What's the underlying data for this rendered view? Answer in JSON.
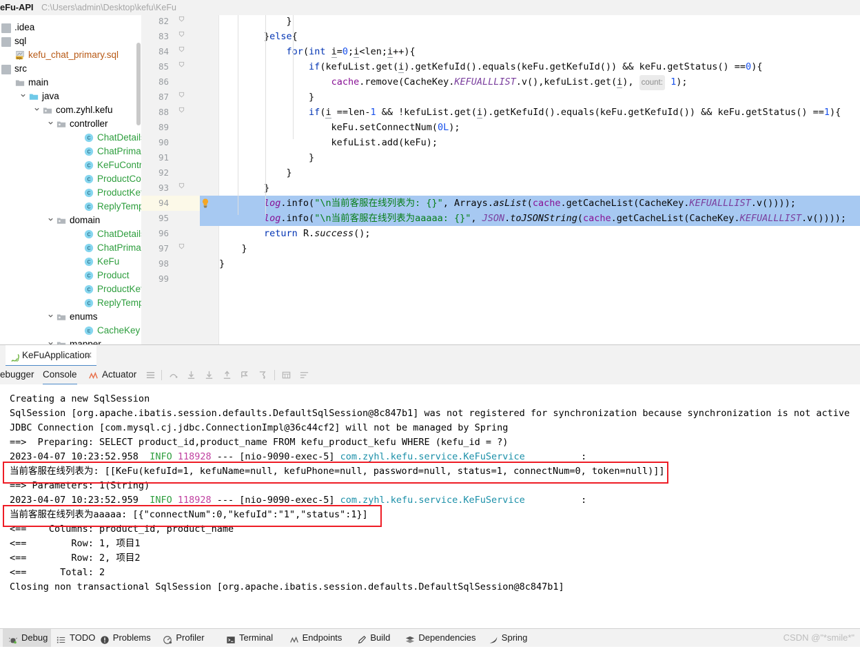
{
  "window": {
    "project_name": "eFu-API",
    "project_path": "C:\\Users\\admin\\Desktop\\kefu\\KeFu"
  },
  "project_tree": {
    "items": [
      {
        "label": ".idea",
        "indent": 0,
        "icon": "module-icon",
        "arrow": "",
        "style": "plain"
      },
      {
        "label": "sql",
        "indent": 0,
        "icon": "module-icon",
        "arrow": "",
        "style": "plain"
      },
      {
        "label": "kefu_chat_primary.sql",
        "indent": 1,
        "icon": "sql-file-icon",
        "arrow": "",
        "style": "sql"
      },
      {
        "label": "src",
        "indent": 0,
        "icon": "module-icon",
        "arrow": "",
        "style": "plain"
      },
      {
        "label": "main",
        "indent": 1,
        "icon": "folder-icon",
        "arrow": "",
        "style": "plain"
      },
      {
        "label": "java",
        "indent": 2,
        "icon": "folder-blue-icon",
        "arrow": "v",
        "style": "plain"
      },
      {
        "label": "com.zyhl.kefu",
        "indent": 3,
        "icon": "package-icon",
        "arrow": "v",
        "style": "plain"
      },
      {
        "label": "controller",
        "indent": 4,
        "icon": "package-icon",
        "arrow": "v",
        "style": "plain"
      },
      {
        "label": "ChatDetailsController",
        "indent": 6,
        "icon": "class-icon",
        "arrow": "",
        "style": "green"
      },
      {
        "label": "ChatPrimaryController",
        "indent": 6,
        "icon": "class-icon",
        "arrow": "",
        "style": "green"
      },
      {
        "label": "KeFuController",
        "indent": 6,
        "icon": "class-icon",
        "arrow": "",
        "style": "green"
      },
      {
        "label": "ProductController",
        "indent": 6,
        "icon": "class-icon",
        "arrow": "",
        "style": "green"
      },
      {
        "label": "ProductKefuController",
        "indent": 6,
        "icon": "class-icon",
        "arrow": "",
        "style": "green"
      },
      {
        "label": "ReplyTemplateController",
        "indent": 6,
        "icon": "class-icon",
        "arrow": "",
        "style": "green"
      },
      {
        "label": "domain",
        "indent": 4,
        "icon": "package-icon",
        "arrow": "v",
        "style": "plain"
      },
      {
        "label": "ChatDetails",
        "indent": 6,
        "icon": "class-icon",
        "arrow": "",
        "style": "green"
      },
      {
        "label": "ChatPrimary",
        "indent": 6,
        "icon": "class-icon",
        "arrow": "",
        "style": "green"
      },
      {
        "label": "KeFu",
        "indent": 6,
        "icon": "class-icon",
        "arrow": "",
        "style": "green"
      },
      {
        "label": "Product",
        "indent": 6,
        "icon": "class-icon",
        "arrow": "",
        "style": "green"
      },
      {
        "label": "ProductKefu",
        "indent": 6,
        "icon": "class-icon",
        "arrow": "",
        "style": "green"
      },
      {
        "label": "ReplyTemplate",
        "indent": 6,
        "icon": "class-icon",
        "arrow": "",
        "style": "green"
      },
      {
        "label": "enums",
        "indent": 4,
        "icon": "package-icon",
        "arrow": "v",
        "style": "plain"
      },
      {
        "label": "CacheKey",
        "indent": 6,
        "icon": "enum-icon",
        "arrow": "",
        "style": "green"
      },
      {
        "label": "mapper",
        "indent": 4,
        "icon": "package-icon",
        "arrow": "v",
        "style": "plain"
      }
    ]
  },
  "editor": {
    "line_numbers": [
      "82",
      "83",
      "84",
      "85",
      "86",
      "87",
      "88",
      "89",
      "90",
      "91",
      "92",
      "93",
      "94",
      "95",
      "96",
      "97",
      "98",
      "99"
    ],
    "caret_line": "94",
    "selected_lines": [
      "94",
      "95"
    ],
    "lines": [
      {
        "num": "82",
        "text": "            }"
      },
      {
        "num": "83",
        "text": "        }else{"
      },
      {
        "num": "84",
        "text": "            for(int i=0;i<len;i++){"
      },
      {
        "num": "85",
        "text": "                if(kefuList.get(i).getKefuId().equals(keFu.getKefuId()) && keFu.getStatus() ==0){"
      },
      {
        "num": "86",
        "text": "                    cache.remove(CacheKey.KEFUALLLIST.v(),kefuList.get(i), count: 1);"
      },
      {
        "num": "87",
        "text": "                }"
      },
      {
        "num": "88",
        "text": "                if(i ==len-1 && !kefuList.get(i).getKefuId().equals(keFu.getKefuId()) && keFu.getStatus() ==1){"
      },
      {
        "num": "89",
        "text": "                    keFu.setConnectNum(0L);"
      },
      {
        "num": "90",
        "text": "                    kefuList.add(keFu);"
      },
      {
        "num": "91",
        "text": "                }"
      },
      {
        "num": "92",
        "text": "            }"
      },
      {
        "num": "93",
        "text": "        }"
      },
      {
        "num": "94",
        "text": "        log.info(\"\\n当前客服在线列表为: {}\", Arrays.asList(cache.getCacheList(CacheKey.KEFUALLLIST.v())));"
      },
      {
        "num": "95",
        "text": "        log.info(\"\\n当前客服在线列表为aaaaa: {}\", JSON.toJSONString(cache.getCacheList(CacheKey.KEFUALLLIST.v())));"
      },
      {
        "num": "96",
        "text": "        return R.success();"
      },
      {
        "num": "97",
        "text": "    }"
      },
      {
        "num": "98",
        "text": "}"
      },
      {
        "num": "99",
        "text": ""
      }
    ],
    "inlay_hint": "count:"
  },
  "run_window": {
    "tab_label": "KeFuApplication",
    "tab_close": "✕",
    "sub_tabs": [
      {
        "label": "ebugger",
        "active": false
      },
      {
        "label": "Console",
        "active": true
      },
      {
        "label": "Actuator",
        "active": false
      }
    ],
    "toolbar_icons": [
      "menu-icon",
      "step-over-icon",
      "step-into-icon",
      "force-step-into-icon",
      "step-out-icon",
      "run-to-cursor-icon",
      "drop-frame-icon",
      "evaluate-expression-icon",
      "settings-icon"
    ],
    "console_lines": [
      {
        "segments": [
          {
            "t": "Creating a new SqlSession",
            "c": "plain"
          }
        ]
      },
      {
        "segments": [
          {
            "t": "SqlSession [org.apache.ibatis.session.defaults.DefaultSqlSession@8c847b1] was not registered for synchronization because synchronization is not active",
            "c": "plain"
          }
        ]
      },
      {
        "segments": [
          {
            "t": "JDBC Connection [com.mysql.cj.jdbc.ConnectionImpl@36c44cf2] will not be managed by Spring",
            "c": "plain"
          }
        ]
      },
      {
        "segments": [
          {
            "t": "==>  Preparing: SELECT product_id,product_name FROM kefu_product_kefu WHERE (kefu_id = ?)",
            "c": "plain"
          }
        ]
      },
      {
        "segments": [
          {
            "t": "2023-04-07 10:23:52.958  ",
            "c": "plain"
          },
          {
            "t": "INFO",
            "c": "info"
          },
          {
            "t": " ",
            "c": "plain"
          },
          {
            "t": "118928",
            "c": "pid"
          },
          {
            "t": " --- [nio-9090-exec-5] ",
            "c": "plain"
          },
          {
            "t": "com.zyhl.kefu.service.KeFuService",
            "c": "logger"
          },
          {
            "t": "          :",
            "c": "plain"
          }
        ]
      },
      {
        "segments": [
          {
            "t": "当前客服在线列表为: [[KeFu(kefuId=1, kefuName=null, kefuPhone=null, password=null, status=1, connectNum=0, token=null)]]",
            "c": "plain"
          }
        ]
      },
      {
        "segments": [
          {
            "t": "==> Parameters: 1(String)",
            "c": "plain"
          }
        ]
      },
      {
        "segments": [
          {
            "t": "2023-04-07 10:23:52.959  ",
            "c": "plain"
          },
          {
            "t": "INFO",
            "c": "info"
          },
          {
            "t": " ",
            "c": "plain"
          },
          {
            "t": "118928",
            "c": "pid"
          },
          {
            "t": " --- [nio-9090-exec-5] ",
            "c": "plain"
          },
          {
            "t": "com.zyhl.kefu.service.KeFuService",
            "c": "logger"
          },
          {
            "t": "          :",
            "c": "plain"
          }
        ]
      },
      {
        "segments": [
          {
            "t": "当前客服在线列表为aaaaa: [{\"connectNum\":0,\"kefuId\":\"1\",\"status\":1}]",
            "c": "plain"
          }
        ]
      },
      {
        "segments": [
          {
            "t": "<==    Columns: product_id, product_name",
            "c": "plain"
          }
        ]
      },
      {
        "segments": [
          {
            "t": "<==        Row: 1, 项目1",
            "c": "plain"
          }
        ]
      },
      {
        "segments": [
          {
            "t": "<==        Row: 2, 项目2",
            "c": "plain"
          }
        ]
      },
      {
        "segments": [
          {
            "t": "<==      Total: 2",
            "c": "plain"
          }
        ]
      },
      {
        "segments": [
          {
            "t": "Closing non transactional SqlSession [org.apache.ibatis.session.defaults.DefaultSqlSession@8c847b1]",
            "c": "plain"
          }
        ]
      }
    ],
    "highlight_color": "#ee1c25"
  },
  "status_bar": {
    "items": [
      {
        "label": "Debug",
        "icon": "debug-icon",
        "selected": true
      },
      {
        "label": "TODO",
        "icon": "todo-icon",
        "selected": false
      },
      {
        "label": "Problems",
        "icon": "problems-icon",
        "selected": false
      },
      {
        "label": "Profiler",
        "icon": "profiler-icon",
        "selected": false
      },
      {
        "label": "Terminal",
        "icon": "terminal-icon",
        "selected": false
      },
      {
        "label": "Endpoints",
        "icon": "endpoints-icon",
        "selected": false
      },
      {
        "label": "Build",
        "icon": "build-icon",
        "selected": false
      },
      {
        "label": "Dependencies",
        "icon": "dependencies-icon",
        "selected": false
      },
      {
        "label": "Spring",
        "icon": "spring-icon",
        "selected": false
      }
    ],
    "watermark": "CSDN @\"*smile*\""
  }
}
